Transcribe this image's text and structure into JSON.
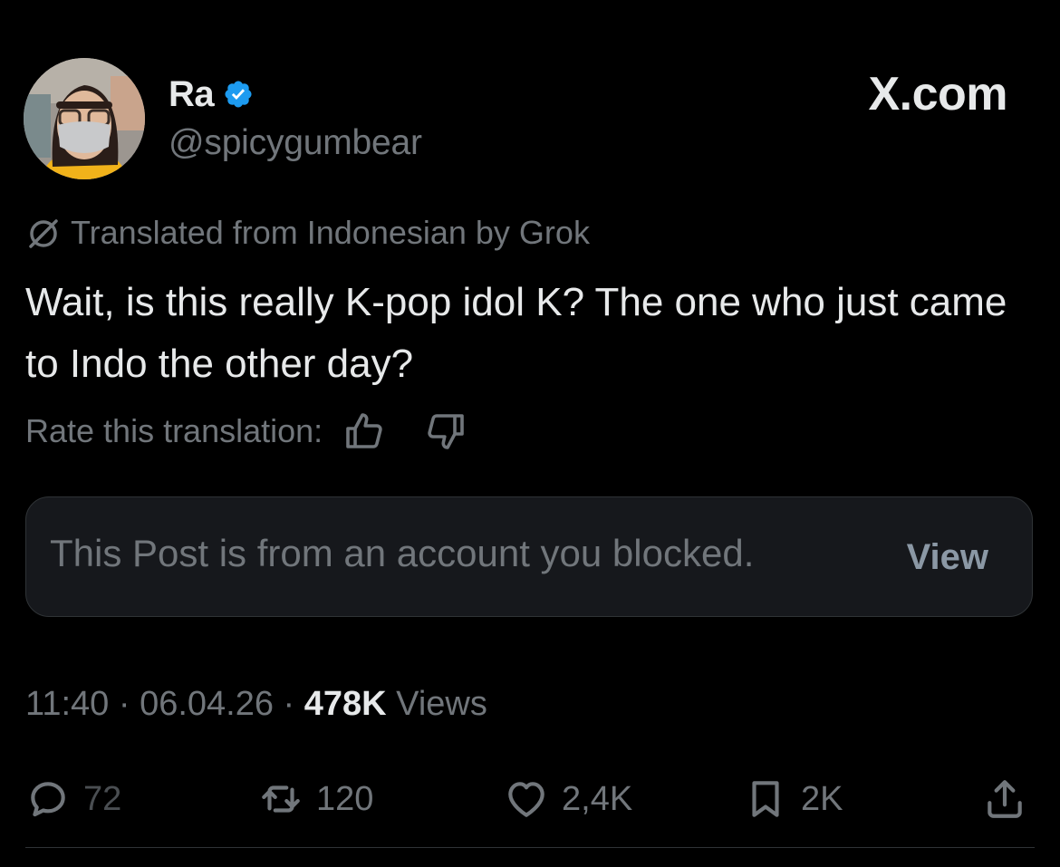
{
  "brand": {
    "label": "X.com"
  },
  "author": {
    "display_name": "Ra",
    "handle": "@spicygumbear",
    "verified": true,
    "verified_color": "#1d9bf0",
    "avatar_icon": "avatar"
  },
  "translation": {
    "notice": "Translated from Indonesian by Grok",
    "rate_label": "Rate this translation:",
    "icons": [
      "grok-icon",
      "thumbs-up-icon",
      "thumbs-down-icon"
    ]
  },
  "post": {
    "text": "Wait, is this really K-pop idol K? The one who just came to Indo the other day?"
  },
  "blocked_card": {
    "message": "This Post is from an account you blocked.",
    "button_label": "View"
  },
  "meta": {
    "time": "11:40",
    "date": "06.04.26",
    "separator": "·",
    "views_count": "478K",
    "views_label": "Views"
  },
  "actions": {
    "replies": "72",
    "reposts": "120",
    "likes": "2,4K",
    "bookmarks": "2K"
  },
  "colors": {
    "background": "#000000",
    "primary_text": "#e7e9ea",
    "secondary_text": "#71767b",
    "card_background": "#16181c",
    "border": "#2f3336"
  }
}
